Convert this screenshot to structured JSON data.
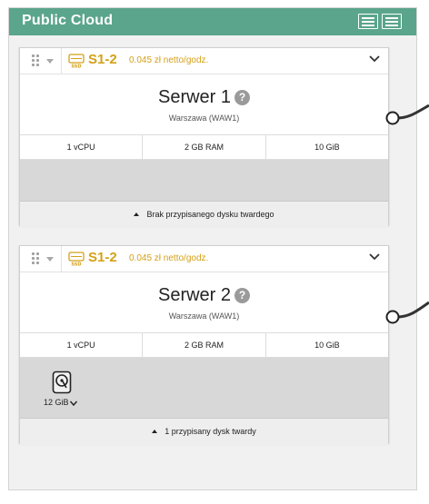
{
  "panel": {
    "title": "Public Cloud"
  },
  "servers": [
    {
      "plan": "S1-2",
      "price": "0.045 zł netto/godz.",
      "name": "Serwer 1",
      "help": "?",
      "location": "Warszawa (WAW1)",
      "specs": [
        "1 vCPU",
        "2 GB RAM",
        "10 GiB"
      ],
      "disks": [],
      "disk_footer": "Brak przypisanego dysku twardego"
    },
    {
      "plan": "S1-2",
      "price": "0.045 zł netto/godz.",
      "name": "Serwer 2",
      "help": "?",
      "location": "Warszawa (WAW1)",
      "specs": [
        "1 vCPU",
        "2 GB RAM",
        "10 GiB"
      ],
      "disks": [
        {
          "size": "12 GiB",
          "icon": "hard-disk-icon"
        }
      ],
      "disk_footer": "1 przypisany dysk twardy"
    }
  ],
  "colors": {
    "header": "#5aa58b",
    "plan_accent": "#d4a017",
    "disk_area": "#d8d8d8"
  },
  "icons": [
    "drag-handle-icon",
    "caret-down-icon",
    "ssd-icon",
    "chevron-down-icon",
    "help-icon",
    "hard-disk-icon",
    "triangle-up-icon",
    "view-toggle-icon"
  ]
}
